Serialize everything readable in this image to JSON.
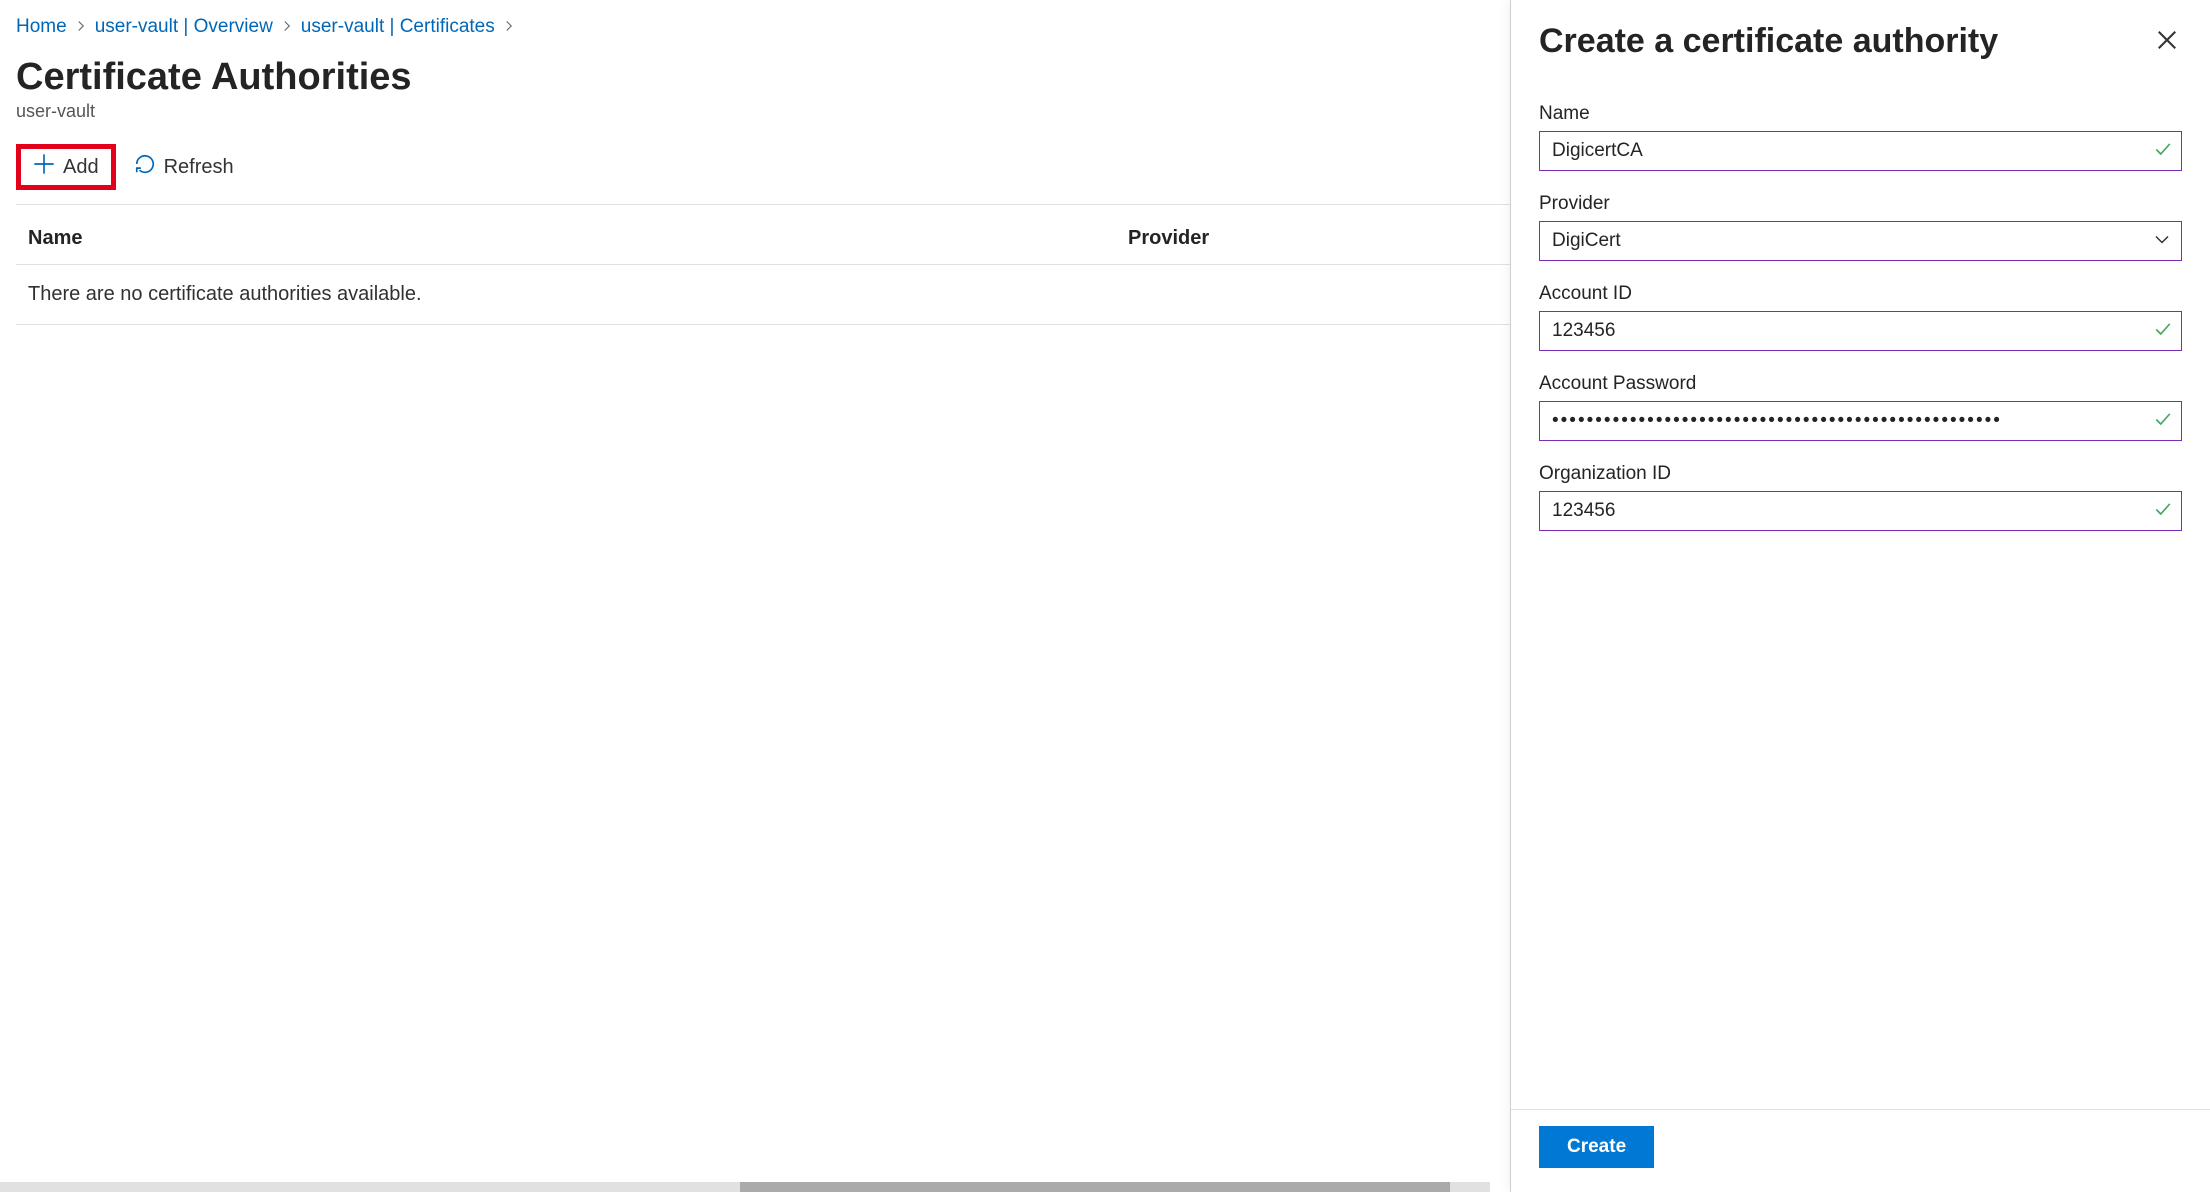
{
  "breadcrumb": {
    "home": "Home",
    "overview": "user-vault | Overview",
    "certificates": "user-vault | Certificates"
  },
  "page": {
    "title": "Certificate Authorities",
    "subtitle": "user-vault"
  },
  "toolbar": {
    "add_label": "Add",
    "refresh_label": "Refresh"
  },
  "table": {
    "col_name": "Name",
    "col_provider": "Provider",
    "empty_message": "There are no certificate authorities available."
  },
  "panel": {
    "title": "Create a certificate authority",
    "fields": {
      "name_label": "Name",
      "name_value": "DigicertCA",
      "provider_label": "Provider",
      "provider_value": "DigiCert",
      "account_id_label": "Account ID",
      "account_id_value": "123456",
      "account_password_label": "Account Password",
      "account_password_value": "••••••••••••••••••••••••••••••••••••••••••••••••••••",
      "org_id_label": "Organization ID",
      "org_id_value": "123456"
    },
    "create_label": "Create"
  },
  "colors": {
    "accent": "#0078d4",
    "link": "#0067b8",
    "field_border": "#7a2db6",
    "highlight": "#e3001b",
    "success": "#4aa564"
  }
}
